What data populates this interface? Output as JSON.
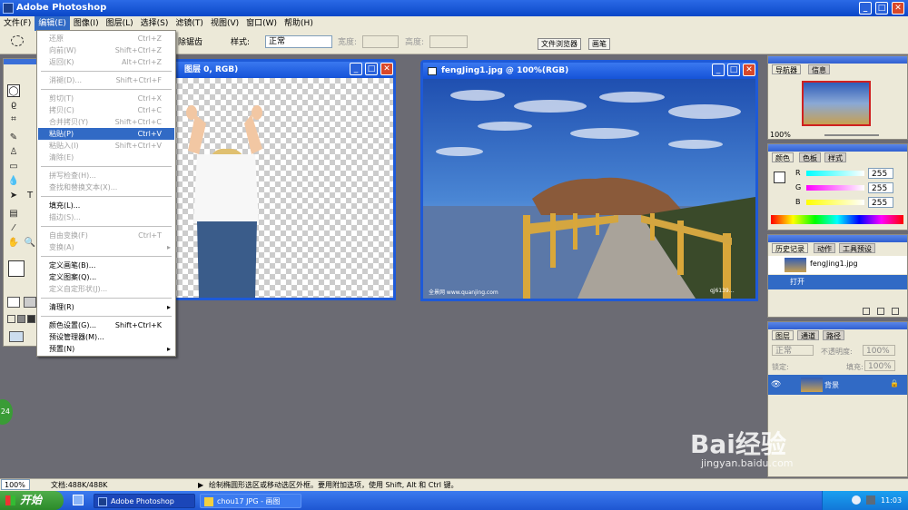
{
  "app": {
    "title": "Adobe Photoshop"
  },
  "menubar": [
    "文件(F)",
    "编辑(E)",
    "图像(I)",
    "图层(L)",
    "选择(S)",
    "滤镜(T)",
    "视图(V)",
    "窗口(W)",
    "帮助(H)"
  ],
  "options": {
    "anti_alias_label": "除锯齿",
    "style_label": "样式:",
    "style_value": "正常",
    "width_label": "宽度:",
    "height_label": "高度:",
    "file_browser_tab": "文件浏览器",
    "brushes_tab": "画笔"
  },
  "edit_menu": [
    {
      "label": "还原",
      "shortcut": "Ctrl+Z"
    },
    {
      "label": "向前(W)",
      "shortcut": "Shift+Ctrl+Z"
    },
    {
      "label": "返回(K)",
      "shortcut": "Alt+Ctrl+Z"
    },
    {
      "label": "消褪(D)...",
      "shortcut": "Shift+Ctrl+F"
    },
    {
      "label": "剪切(T)",
      "shortcut": "Ctrl+X"
    },
    {
      "label": "拷贝(C)",
      "shortcut": "Ctrl+C"
    },
    {
      "label": "合并拷贝(Y)",
      "shortcut": "Shift+Ctrl+C"
    },
    {
      "label": "粘贴(P)",
      "shortcut": "Ctrl+V"
    },
    {
      "label": "粘贴入(I)",
      "shortcut": "Shift+Ctrl+V"
    },
    {
      "label": "清除(E)",
      "shortcut": ""
    },
    {
      "label": "拼写检查(H)...",
      "shortcut": ""
    },
    {
      "label": "查找和替换文本(X)...",
      "shortcut": ""
    },
    {
      "label": "填充(L)...",
      "shortcut": ""
    },
    {
      "label": "描边(S)...",
      "shortcut": ""
    },
    {
      "label": "自由变换(F)",
      "shortcut": "Ctrl+T"
    },
    {
      "label": "变换(A)",
      "shortcut": ""
    },
    {
      "label": "定义画笔(B)...",
      "shortcut": ""
    },
    {
      "label": "定义图案(Q)...",
      "shortcut": ""
    },
    {
      "label": "定义自定形状(J)...",
      "shortcut": ""
    },
    {
      "label": "清理(R)",
      "shortcut": ""
    },
    {
      "label": "颜色设置(G)...",
      "shortcut": "Shift+Ctrl+K"
    },
    {
      "label": "预设管理器(M)...",
      "shortcut": ""
    },
    {
      "label": "预置(N)",
      "shortcut": ""
    }
  ],
  "doc1": {
    "title": "图层 0, RGB)"
  },
  "doc2": {
    "title": "fengJing1.jpg @ 100%(RGB)",
    "watermark_left": "全景网 www.quanjing.com",
    "watermark_right": "qj6139…"
  },
  "navigator": {
    "tabs": [
      "导航器",
      "信息"
    ],
    "zoom": "100%"
  },
  "color_panel": {
    "tabs": [
      "颜色",
      "色板",
      "样式"
    ],
    "r_label": "R",
    "g_label": "G",
    "b_label": "B",
    "r": "255",
    "g": "255",
    "b": "255"
  },
  "history": {
    "tabs": [
      "历史记录",
      "动作",
      "工具预设"
    ],
    "snapshot": "fengJing1.jpg",
    "step": "打开"
  },
  "layers": {
    "tabs": [
      "图层",
      "通道",
      "路径"
    ],
    "blend": "正常",
    "opacity_label": "不透明度:",
    "opacity": "100%",
    "lock_label": "锁定:",
    "fill_label": "填充:",
    "fill": "100%",
    "layer_name": "背景"
  },
  "status": {
    "zoom": "100%",
    "doc": "文档:488K/488K",
    "hint": "绘制椭圆形选区或移动选区外框。要用附加选项，使用 Shift, Alt 和 Ctrl 键。"
  },
  "taskbar": {
    "start": "开始",
    "item1": "Adobe Photoshop",
    "item2": "chou17 JPG - 画图",
    "clock": "11:03"
  },
  "badge": {
    "number": "24"
  },
  "watermark": {
    "brand": "Bai经验",
    "url": "jingyan.baidu.com"
  },
  "colors": {
    "title_blue": "#1553d8",
    "menu_highlight": "#316ac5",
    "workspace": "#6b6b73",
    "start_green": "#3a9c36"
  }
}
